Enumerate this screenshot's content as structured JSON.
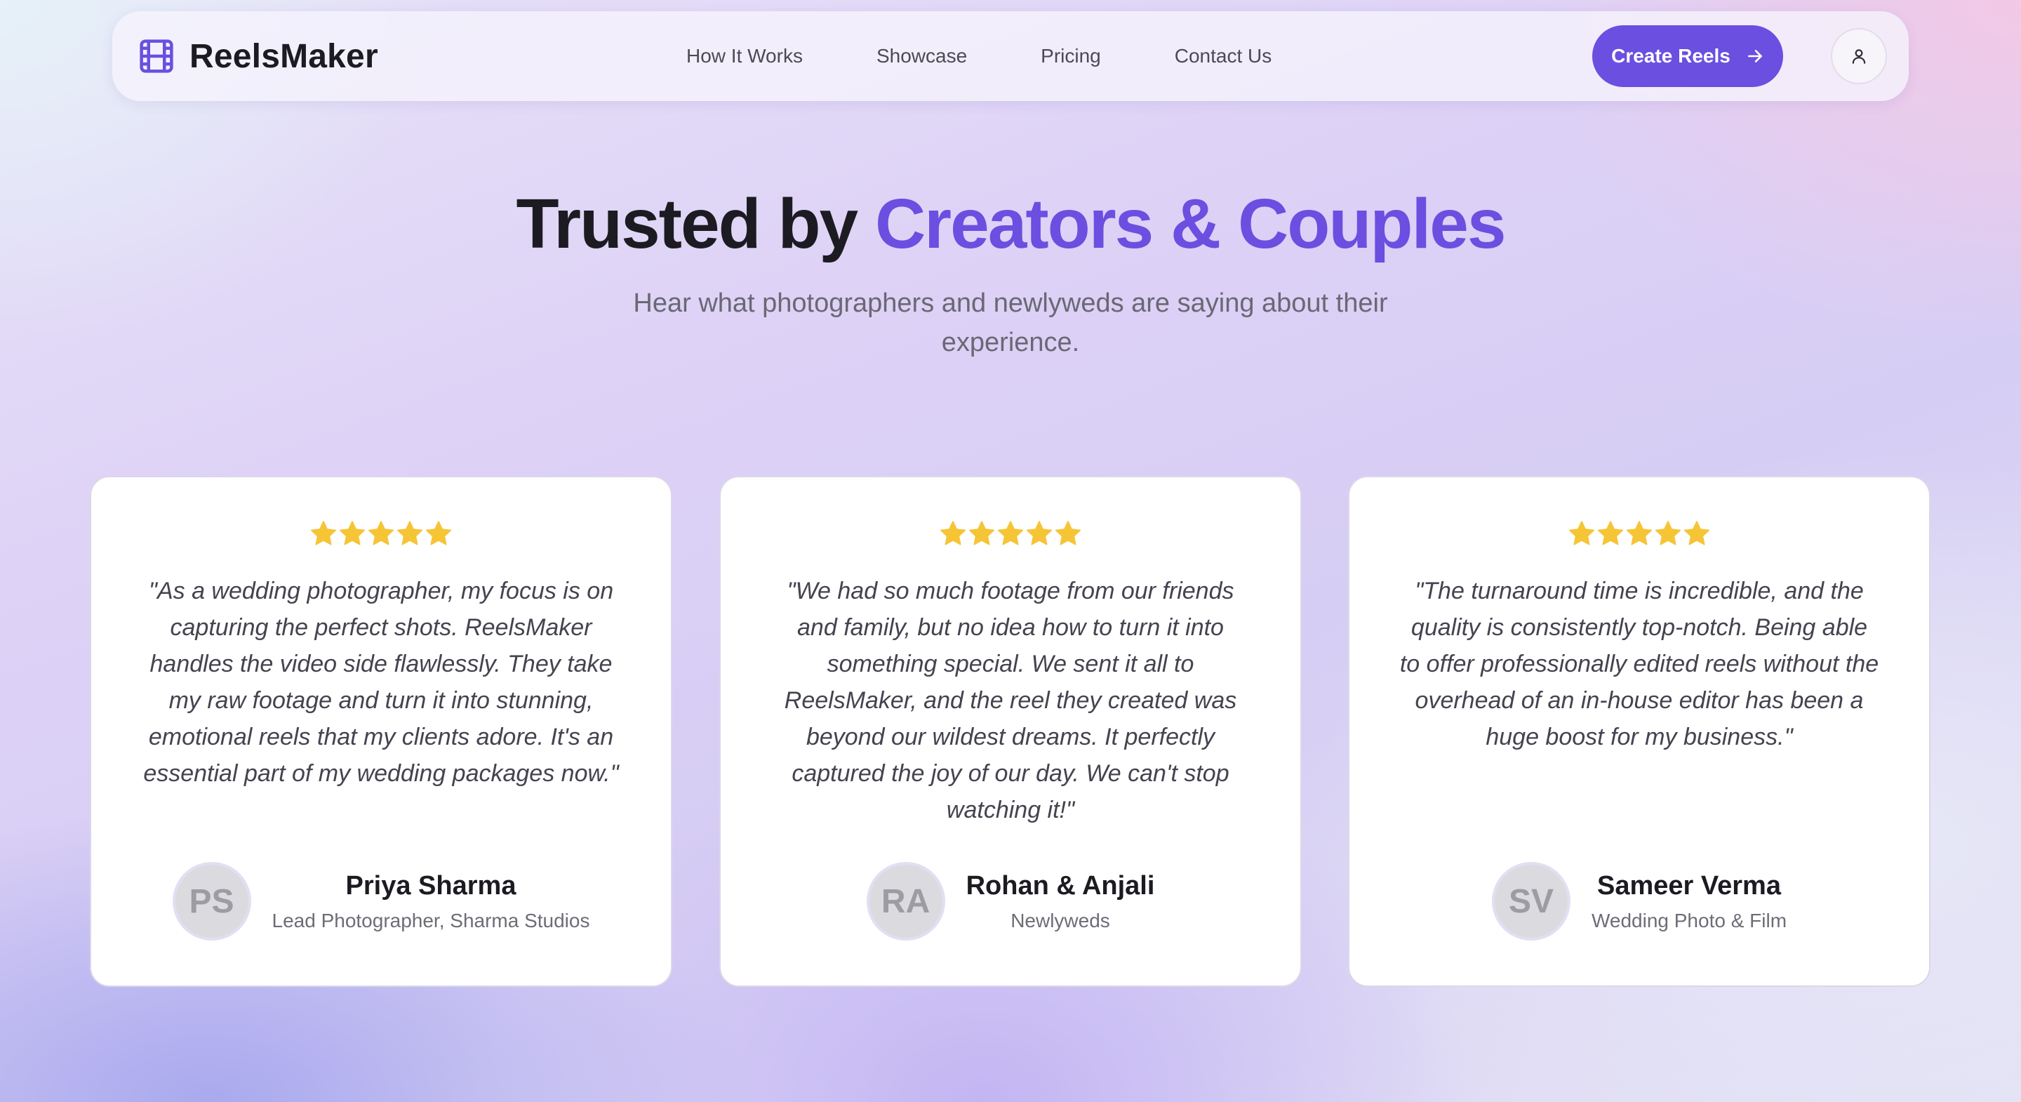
{
  "brand": {
    "name": "ReelsMaker",
    "icon": "film-icon",
    "accent_color": "#6a4fe0"
  },
  "nav": {
    "links": [
      "How It Works",
      "Showcase",
      "Pricing",
      "Contact Us"
    ],
    "cta_label": "Create Reels",
    "cta_icon": "arrow-right-icon",
    "user_icon": "user-icon"
  },
  "hero": {
    "title_plain": "Trusted by ",
    "title_accent": "Creators & Couples",
    "subtitle": "Hear what photographers and newlyweds are saying about their experience."
  },
  "testimonials": [
    {
      "rating": 5,
      "quote": "\"As a wedding photographer, my focus is on capturing the perfect shots. ReelsMaker handles the video side flawlessly. They take my raw footage and turn it into stunning, emotional reels that my clients adore. It's an essential part of my wedding packages now.\"",
      "initials": "PS",
      "name": "Priya Sharma",
      "role": "Lead Photographer, Sharma Studios"
    },
    {
      "rating": 5,
      "quote": "\"We had so much footage from our friends and family, but no idea how to turn it into something special. We sent it all to ReelsMaker, and the reel they created was beyond our wildest dreams. It perfectly captured the joy of our day. We can't stop watching it!\"",
      "initials": "RA",
      "name": "Rohan & Anjali",
      "role": "Newlyweds"
    },
    {
      "rating": 5,
      "quote": "\"The turnaround time is incredible, and the quality is consistently top-notch. Being able to offer professionally edited reels without the overhead of an in-house editor has been a huge boost for my business.\"",
      "initials": "SV",
      "name": "Sameer Verma",
      "role": "Wedding Photo & Film"
    }
  ],
  "colors": {
    "star": "#f5c536",
    "cta": "#6a4fe0",
    "accent_text": "#6a4fe0"
  }
}
